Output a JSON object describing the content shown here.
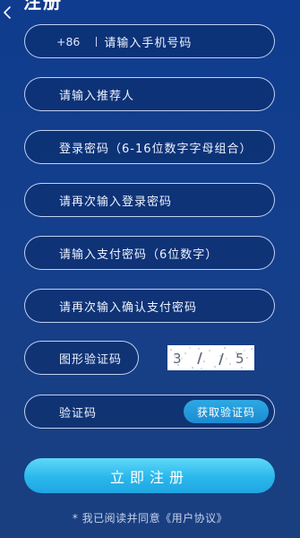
{
  "header": {
    "title": "注册"
  },
  "form": {
    "phone_prefix": "+86",
    "phone_placeholder": "请输入手机号码",
    "referrer_placeholder": "请输入推荐人",
    "login_password_placeholder": "登录密码（6-16位数字字母组合）",
    "confirm_login_password_placeholder": "请再次输入登录密码",
    "pay_password_placeholder": "请输入支付密码（6位数字）",
    "confirm_pay_password_placeholder": "请再次输入确认支付密码",
    "captcha_placeholder": "图形验证码",
    "captcha_text": "3 / / 5",
    "sms_code_placeholder": "验证码",
    "get_code_label": "获取验证码"
  },
  "actions": {
    "register_label": "立即注册",
    "agreement_text": "* 我已阅读并同意《用户协议》"
  },
  "icons": {
    "back": "chevron-left-icon"
  },
  "colors": {
    "background": "#0f3c8e",
    "field_border": "#d6e3ff",
    "button_accent": "#2ab7ec",
    "get_code_button": "#1b8bd3"
  }
}
